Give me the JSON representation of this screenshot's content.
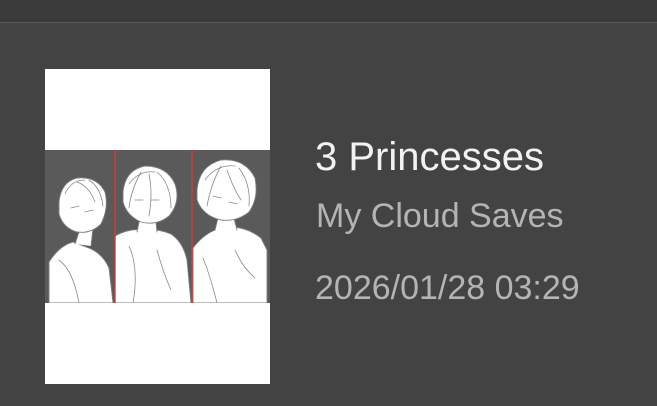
{
  "file": {
    "title": "3 Princesses",
    "location": "My Cloud Saves",
    "modified": "2026/01/28 03:29",
    "thumbnail_icon": "sketch-thumbnail-image"
  },
  "colors": {
    "background": "#434343",
    "title_text": "#f2f2f2",
    "secondary_text": "#b4b4b4",
    "panel_divider": "#d23c3c"
  }
}
